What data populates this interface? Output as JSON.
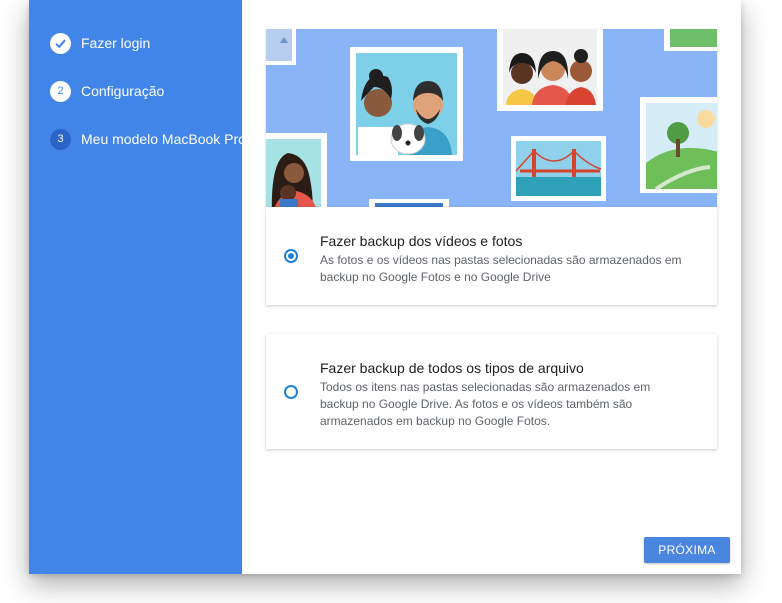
{
  "sidebar": {
    "steps": [
      {
        "label": "Fazer login",
        "state": "done",
        "icon": "checkmark-icon"
      },
      {
        "number": "2",
        "label": "Configuração",
        "state": "pending"
      },
      {
        "number": "3",
        "label": "Meu modelo MacBook Pro",
        "state": "current"
      }
    ]
  },
  "options": [
    {
      "title": "Fazer backup dos vídeos e fotos",
      "description": "As fotos e os vídeos nas pastas selecionadas são armazenados em backup no Google Fotos e no Google Drive",
      "selected": true
    },
    {
      "title": "Fazer backup de todos os tipos de arquivo",
      "description": "Todos os itens nas pastas selecionadas são armazenados em backup no Google Drive. As fotos e os vídeos também são armazenados em backup no Google Fotos.",
      "selected": false
    }
  ],
  "footer": {
    "next_label": "PRÓXIMA"
  },
  "colors": {
    "sidebar": "#4285e8",
    "accent": "#1e80d8",
    "button": "#4a85e0",
    "hero_background": "#8ab4f8"
  }
}
